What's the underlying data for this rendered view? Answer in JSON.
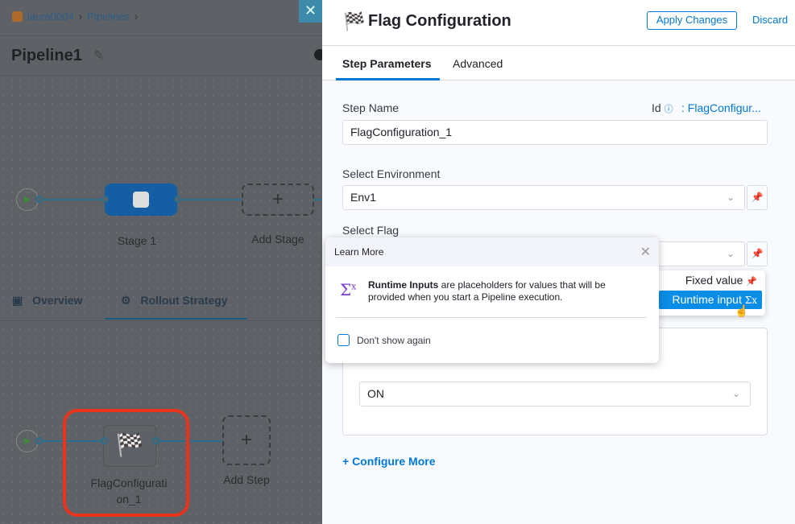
{
  "background": {
    "breadcrumb": [
      "laura0004",
      "Pipelines"
    ],
    "pipeline_title": "Pipeline1",
    "stage_label": "Stage 1",
    "add_stage": "Add Stage",
    "tabs": [
      "Overview",
      "Rollout Strategy"
    ],
    "step_label": "FlagConfigurati on_1",
    "add_step": "Add Step"
  },
  "panel": {
    "title": "Flag Configuration",
    "apply": "Apply Changes",
    "discard": "Discard",
    "tabs": [
      "Step Parameters",
      "Advanced"
    ],
    "step_name_label": "Step Name",
    "id_label": "Id",
    "id_value": ": FlagConfigur...",
    "step_name_value": "FlagConfiguration_1",
    "env_label": "Select Environment",
    "env_value": "Env1",
    "flag_label": "Select Flag",
    "state_value": "ON",
    "configure_more": "+ Configure More"
  },
  "menu": {
    "fixed": "Fixed value",
    "runtime": "Runtime input"
  },
  "popover": {
    "title": "Learn More",
    "bold": "Runtime Inputs",
    "text": " are placeholders for values that will be provided when you start a Pipeline execution.",
    "checkbox": "Don't show again"
  },
  "colors": {
    "accent": "#0278d5",
    "highlight": "#e8341c"
  }
}
